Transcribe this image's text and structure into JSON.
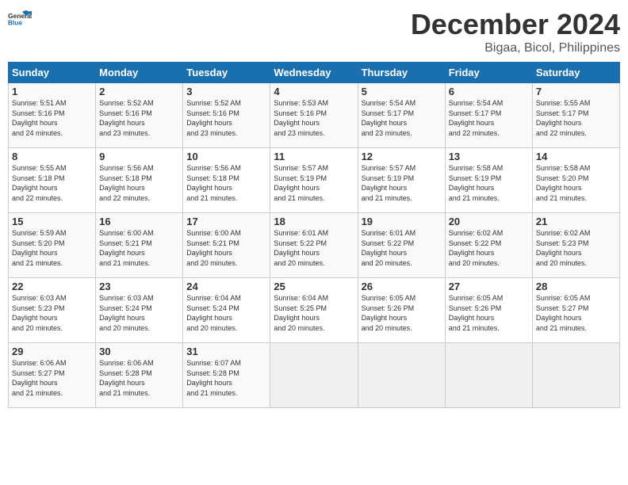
{
  "header": {
    "logo_general": "General",
    "logo_blue": "Blue",
    "month": "December 2024",
    "location": "Bigaa, Bicol, Philippines"
  },
  "calendar": {
    "days_of_week": [
      "Sunday",
      "Monday",
      "Tuesday",
      "Wednesday",
      "Thursday",
      "Friday",
      "Saturday"
    ],
    "weeks": [
      [
        null,
        {
          "day": "2",
          "sunrise": "5:52 AM",
          "sunset": "5:16 PM",
          "daylight": "11 hours and 23 minutes."
        },
        {
          "day": "3",
          "sunrise": "5:52 AM",
          "sunset": "5:16 PM",
          "daylight": "11 hours and 23 minutes."
        },
        {
          "day": "4",
          "sunrise": "5:53 AM",
          "sunset": "5:16 PM",
          "daylight": "11 hours and 23 minutes."
        },
        {
          "day": "5",
          "sunrise": "5:54 AM",
          "sunset": "5:17 PM",
          "daylight": "11 hours and 23 minutes."
        },
        {
          "day": "6",
          "sunrise": "5:54 AM",
          "sunset": "5:17 PM",
          "daylight": "11 hours and 22 minutes."
        },
        {
          "day": "7",
          "sunrise": "5:55 AM",
          "sunset": "5:17 PM",
          "daylight": "11 hours and 22 minutes."
        }
      ],
      [
        {
          "day": "1",
          "sunrise": "5:51 AM",
          "sunset": "5:16 PM",
          "daylight": "11 hours and 24 minutes."
        },
        {
          "day": "9",
          "sunrise": "5:56 AM",
          "sunset": "5:18 PM",
          "daylight": "11 hours and 22 minutes."
        },
        {
          "day": "10",
          "sunrise": "5:56 AM",
          "sunset": "5:18 PM",
          "daylight": "11 hours and 21 minutes."
        },
        {
          "day": "11",
          "sunrise": "5:57 AM",
          "sunset": "5:19 PM",
          "daylight": "11 hours and 21 minutes."
        },
        {
          "day": "12",
          "sunrise": "5:57 AM",
          "sunset": "5:19 PM",
          "daylight": "11 hours and 21 minutes."
        },
        {
          "day": "13",
          "sunrise": "5:58 AM",
          "sunset": "5:19 PM",
          "daylight": "11 hours and 21 minutes."
        },
        {
          "day": "14",
          "sunrise": "5:58 AM",
          "sunset": "5:20 PM",
          "daylight": "11 hours and 21 minutes."
        }
      ],
      [
        {
          "day": "8",
          "sunrise": "5:55 AM",
          "sunset": "5:18 PM",
          "daylight": "11 hours and 22 minutes."
        },
        {
          "day": "16",
          "sunrise": "6:00 AM",
          "sunset": "5:21 PM",
          "daylight": "11 hours and 21 minutes."
        },
        {
          "day": "17",
          "sunrise": "6:00 AM",
          "sunset": "5:21 PM",
          "daylight": "11 hours and 20 minutes."
        },
        {
          "day": "18",
          "sunrise": "6:01 AM",
          "sunset": "5:22 PM",
          "daylight": "11 hours and 20 minutes."
        },
        {
          "day": "19",
          "sunrise": "6:01 AM",
          "sunset": "5:22 PM",
          "daylight": "11 hours and 20 minutes."
        },
        {
          "day": "20",
          "sunrise": "6:02 AM",
          "sunset": "5:22 PM",
          "daylight": "11 hours and 20 minutes."
        },
        {
          "day": "21",
          "sunrise": "6:02 AM",
          "sunset": "5:23 PM",
          "daylight": "11 hours and 20 minutes."
        }
      ],
      [
        {
          "day": "15",
          "sunrise": "5:59 AM",
          "sunset": "5:20 PM",
          "daylight": "11 hours and 21 minutes."
        },
        {
          "day": "23",
          "sunrise": "6:03 AM",
          "sunset": "5:24 PM",
          "daylight": "11 hours and 20 minutes."
        },
        {
          "day": "24",
          "sunrise": "6:04 AM",
          "sunset": "5:24 PM",
          "daylight": "11 hours and 20 minutes."
        },
        {
          "day": "25",
          "sunrise": "6:04 AM",
          "sunset": "5:25 PM",
          "daylight": "11 hours and 20 minutes."
        },
        {
          "day": "26",
          "sunrise": "6:05 AM",
          "sunset": "5:26 PM",
          "daylight": "11 hours and 20 minutes."
        },
        {
          "day": "27",
          "sunrise": "6:05 AM",
          "sunset": "5:26 PM",
          "daylight": "11 hours and 21 minutes."
        },
        {
          "day": "28",
          "sunrise": "6:05 AM",
          "sunset": "5:27 PM",
          "daylight": "11 hours and 21 minutes."
        }
      ],
      [
        {
          "day": "22",
          "sunrise": "6:03 AM",
          "sunset": "5:23 PM",
          "daylight": "11 hours and 20 minutes."
        },
        {
          "day": "30",
          "sunrise": "6:06 AM",
          "sunset": "5:28 PM",
          "daylight": "11 hours and 21 minutes."
        },
        {
          "day": "31",
          "sunrise": "6:07 AM",
          "sunset": "5:28 PM",
          "daylight": "11 hours and 21 minutes."
        },
        null,
        null,
        null,
        null
      ],
      [
        {
          "day": "29",
          "sunrise": "6:06 AM",
          "sunset": "5:27 PM",
          "daylight": "11 hours and 21 minutes."
        },
        null,
        null,
        null,
        null,
        null,
        null
      ]
    ]
  }
}
